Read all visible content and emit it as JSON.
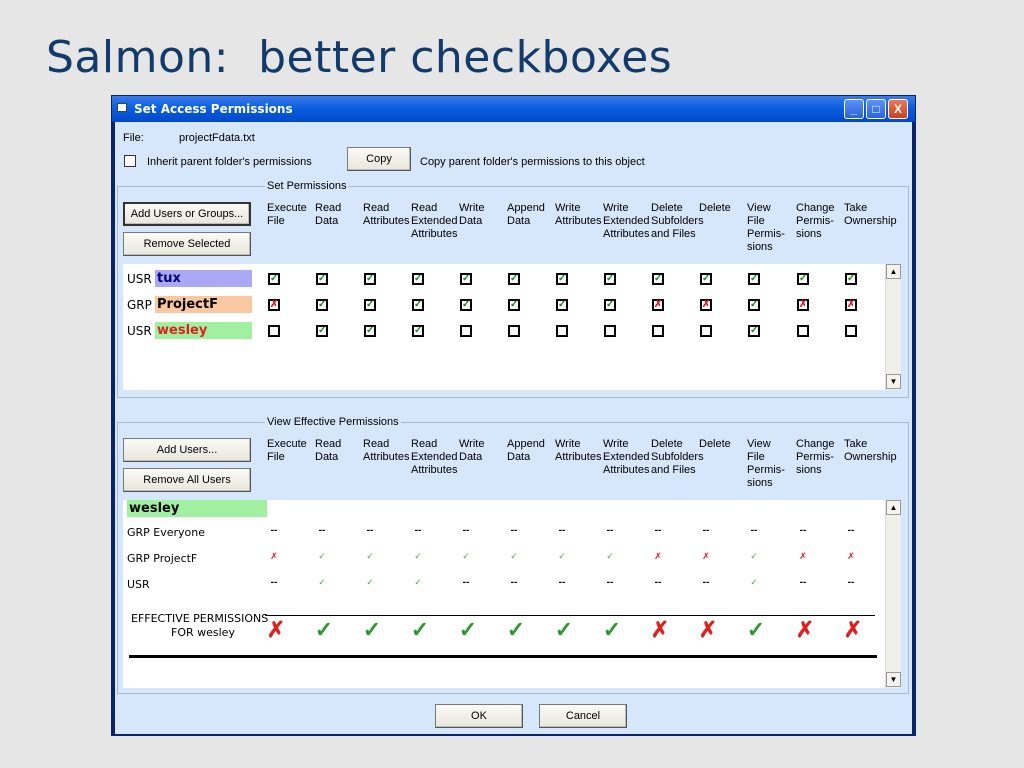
{
  "slide": {
    "title": "Salmon:  better checkboxes"
  },
  "window": {
    "title": "Set Access Permissions",
    "min": "_",
    "max": "□",
    "close": "X"
  },
  "file": {
    "label": "File:",
    "name": "projectFdata.txt"
  },
  "inherit": {
    "label": "Inherit parent folder's permissions",
    "checked": false
  },
  "copy": {
    "button": "Copy",
    "desc": "Copy parent folder's permissions to this object"
  },
  "set_perms": {
    "legend": "Set Permissions",
    "add_button": "Add Users or Groups...",
    "remove_button": "Remove Selected",
    "rows": [
      {
        "type": "USR",
        "name": "tux",
        "color": "#a9a9f5",
        "text_color": "#000080",
        "states": [
          "g",
          "g",
          "g",
          "g",
          "g",
          "g",
          "g",
          "g",
          "g",
          "g",
          "g",
          "g",
          "g"
        ]
      },
      {
        "type": "GRP",
        "name": "ProjectF",
        "color": "#fac8a0",
        "text_color": "#000",
        "states": [
          "r",
          "g",
          "g",
          "g",
          "g",
          "g",
          "g",
          "g",
          "r",
          "r",
          "g",
          "r",
          "r"
        ]
      },
      {
        "type": "USR",
        "name": "wesley",
        "color": "#a0f0a0",
        "text_color": "#e02020",
        "states": [
          "e",
          "g",
          "g",
          "g",
          "e",
          "e",
          "e",
          "e",
          "e",
          "e",
          "g",
          "e",
          "e"
        ]
      }
    ]
  },
  "columns": [
    "Execute\nFile",
    "Read\nData",
    "Read\nAttributes",
    "Read\nExtended\nAttributes",
    "Write\nData",
    "Append\nData",
    "Write\nAttributes",
    "Write\nExtended\nAttributes",
    "Delete\nSubfolders\nand Files",
    "Delete",
    "View\nFile\nPermis-\nsions",
    "Change\nPermis-\nsions",
    "Take\nOwnership"
  ],
  "eff_perms": {
    "legend": "View Effective Permissions",
    "add_button": "Add Users...",
    "remove_button": "Remove All Users",
    "user": "wesley",
    "rows": [
      {
        "label": "GRP Everyone",
        "cells": [
          "n",
          "n",
          "n",
          "n",
          "n",
          "n",
          "n",
          "n",
          "n",
          "n",
          "n",
          "n",
          "n"
        ]
      },
      {
        "label": "GRP ProjectF",
        "cells": [
          "r",
          "g",
          "g",
          "g",
          "g",
          "g",
          "g",
          "g",
          "r",
          "r",
          "g",
          "r",
          "r"
        ]
      },
      {
        "label": "USR",
        "cells": [
          "n",
          "g",
          "g",
          "g",
          "n",
          "n",
          "n",
          "n",
          "n",
          "n",
          "g",
          "n",
          "n"
        ]
      }
    ],
    "effective_label_1": "EFFECTIVE PERMISSIONS",
    "effective_label_2": "FOR wesley",
    "effective": [
      "r",
      "g",
      "g",
      "g",
      "g",
      "g",
      "g",
      "g",
      "r",
      "r",
      "g",
      "r",
      "r"
    ]
  },
  "symbols": {
    "check": "✓",
    "cross": "✗",
    "none": "--",
    "up": "▲",
    "down": "▼"
  },
  "footer": {
    "ok": "OK",
    "cancel": "Cancel"
  }
}
